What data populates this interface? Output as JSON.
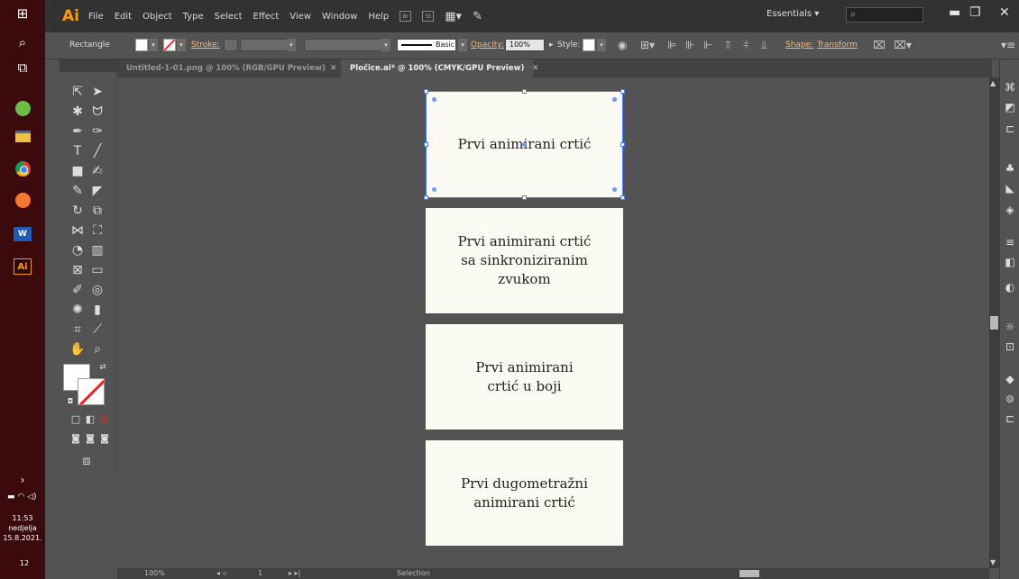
{
  "taskbar": {
    "time": "11:53",
    "day": "nedjelja",
    "date": "15.8.2021.",
    "notification_count": "12",
    "word_label": "W",
    "ai_label": "Ai"
  },
  "menubar": {
    "app": "Ai",
    "items": [
      "File",
      "Edit",
      "Object",
      "Type",
      "Select",
      "Effect",
      "View",
      "Window",
      "Help"
    ],
    "br_label": "Br",
    "st_label": "St",
    "workspace": "Essentials"
  },
  "controlbar": {
    "tool_name": "Rectangle",
    "stroke_label": "Stroke:",
    "brush_label": "Basic",
    "opacity_label": "Opacity:",
    "opacity_value": "100%",
    "style_label": "Style:",
    "shape_label": "Shape:",
    "transform_label": "Transform"
  },
  "tabs": [
    {
      "label": "Untitled-1-01.png @ 100% (RGB/GPU Preview)"
    },
    {
      "label": "Pločice.ai* @ 100% (CMYK/GPU Preview)"
    }
  ],
  "artboards": [
    {
      "text": "Prvi animirani crtić"
    },
    {
      "text": "Prvi animirani crtić sa sinkroniziranim zvukom"
    },
    {
      "text": "Prvi animirani crtić u boji"
    },
    {
      "text": "Prvi dugometražni animirani crtić"
    }
  ],
  "statusbar": {
    "zoom": "100%",
    "page": "1",
    "mode": "Selection"
  },
  "colors": {
    "accent": "#ff9a00",
    "selection": "#4a7cff",
    "artboard": "#fbfaf3",
    "taskbar": "#3a0a0c"
  }
}
